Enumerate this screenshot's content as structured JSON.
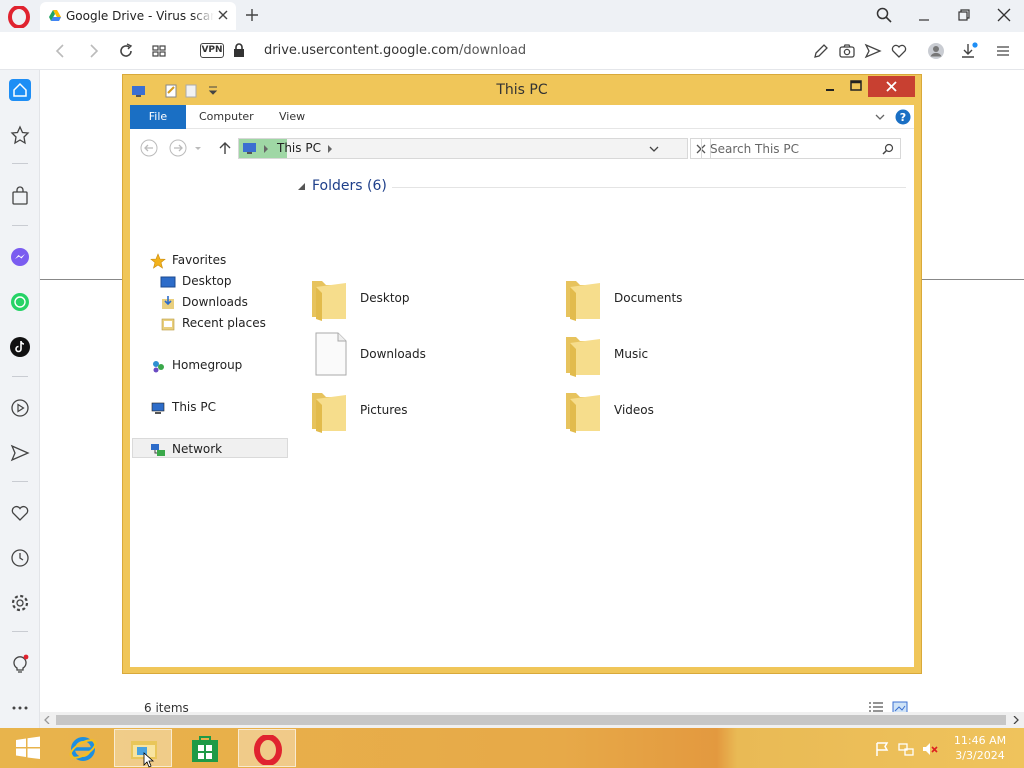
{
  "browser": {
    "tab_title": "Google Drive - Virus scan warning",
    "url_host": "drive.usercontent.google.com",
    "url_path": "/download",
    "vpn_label": "VPN"
  },
  "explorer": {
    "window_title": "This PC",
    "ribbon_tabs": [
      "File",
      "Computer",
      "View"
    ],
    "breadcrumb": "This PC",
    "search_placeholder": "Search This PC",
    "nav_pane": {
      "favorites": "Favorites",
      "desktop": "Desktop",
      "downloads": "Downloads",
      "recent": "Recent places",
      "homegroup": "Homegroup",
      "this_pc": "This PC",
      "network": "Network"
    },
    "group_label": "Folders (6)",
    "folders": [
      "Desktop",
      "Documents",
      "Downloads",
      "Music",
      "Pictures",
      "Videos"
    ],
    "status_text": "6 items"
  },
  "taskbar": {
    "time": "11:46 AM",
    "date": "3/3/2024"
  },
  "colors": {
    "explorer_frame": "#f0c659",
    "file_tab": "#1a6fc4",
    "close_button": "#c84031",
    "opera_red": "#e0232f",
    "sidebar_active": "#1e8ef5"
  }
}
